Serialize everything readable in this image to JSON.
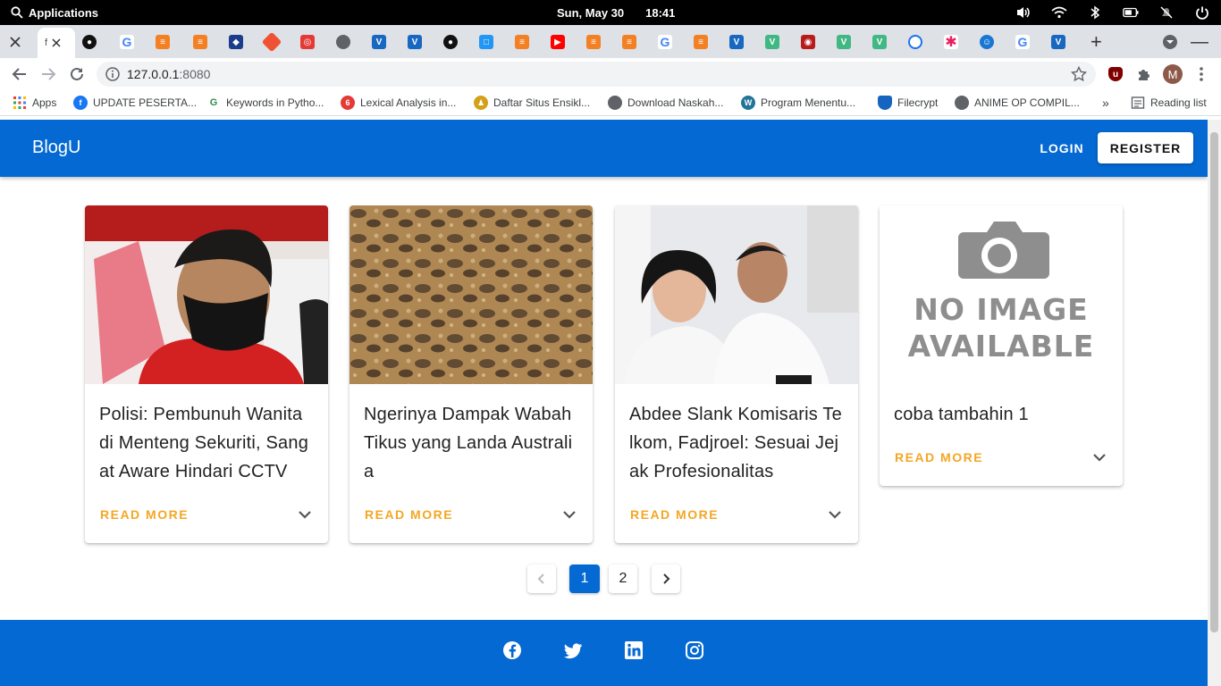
{
  "system_bar": {
    "applications_label": "Applications",
    "date": "Sun, May 30",
    "time": "18:41"
  },
  "browser": {
    "tab_count": 30,
    "address": {
      "host": "127.0.0.1",
      "port": ":8080"
    },
    "bookmarks": [
      {
        "label": "Apps"
      },
      {
        "label": "UPDATE PESERTA..."
      },
      {
        "label": "Keywords in Pytho..."
      },
      {
        "label": "Lexical Analysis in..."
      },
      {
        "label": "Daftar Situs Ensikl..."
      },
      {
        "label": "Download Naskah..."
      },
      {
        "label": "Program Menentu..."
      },
      {
        "label": "Filecrypt"
      },
      {
        "label": "ANIME OP COMPIL..."
      }
    ],
    "more_bookmarks": "»",
    "reading_list": "Reading list",
    "profile_initial": "M"
  },
  "app": {
    "brand": "BlogU",
    "login_label": "LOGIN",
    "register_label": "REGISTER"
  },
  "posts": [
    {
      "title": "Polisi: Pembunuh Wanita di Menteng Sekuriti, Sangat Aware Hindari CCTV",
      "action": "READ MORE",
      "image": "photo-man-mask"
    },
    {
      "title": "Ngerinya Dampak Wabah Tikus yang Landa Australia",
      "action": "READ MORE",
      "image": "photo-mice"
    },
    {
      "title": "Abdee Slank Komisaris Telkom, Fadjroel: Sesuai Jejak Profesionalitas",
      "action": "READ MORE",
      "image": "photo-two-men"
    },
    {
      "title": "coba tambahin 1",
      "action": "READ MORE",
      "image": "no-image-placeholder",
      "placeholder_text": [
        "NO IMAGE",
        "AVAILABLE"
      ]
    }
  ],
  "pagination": {
    "pages": [
      "1",
      "2"
    ],
    "current": "1"
  },
  "footer": {
    "social": [
      "facebook-icon",
      "twitter-icon",
      "linkedin-icon",
      "instagram-icon"
    ]
  },
  "colors": {
    "primary": "#0469d2",
    "accent": "#f5a623"
  }
}
